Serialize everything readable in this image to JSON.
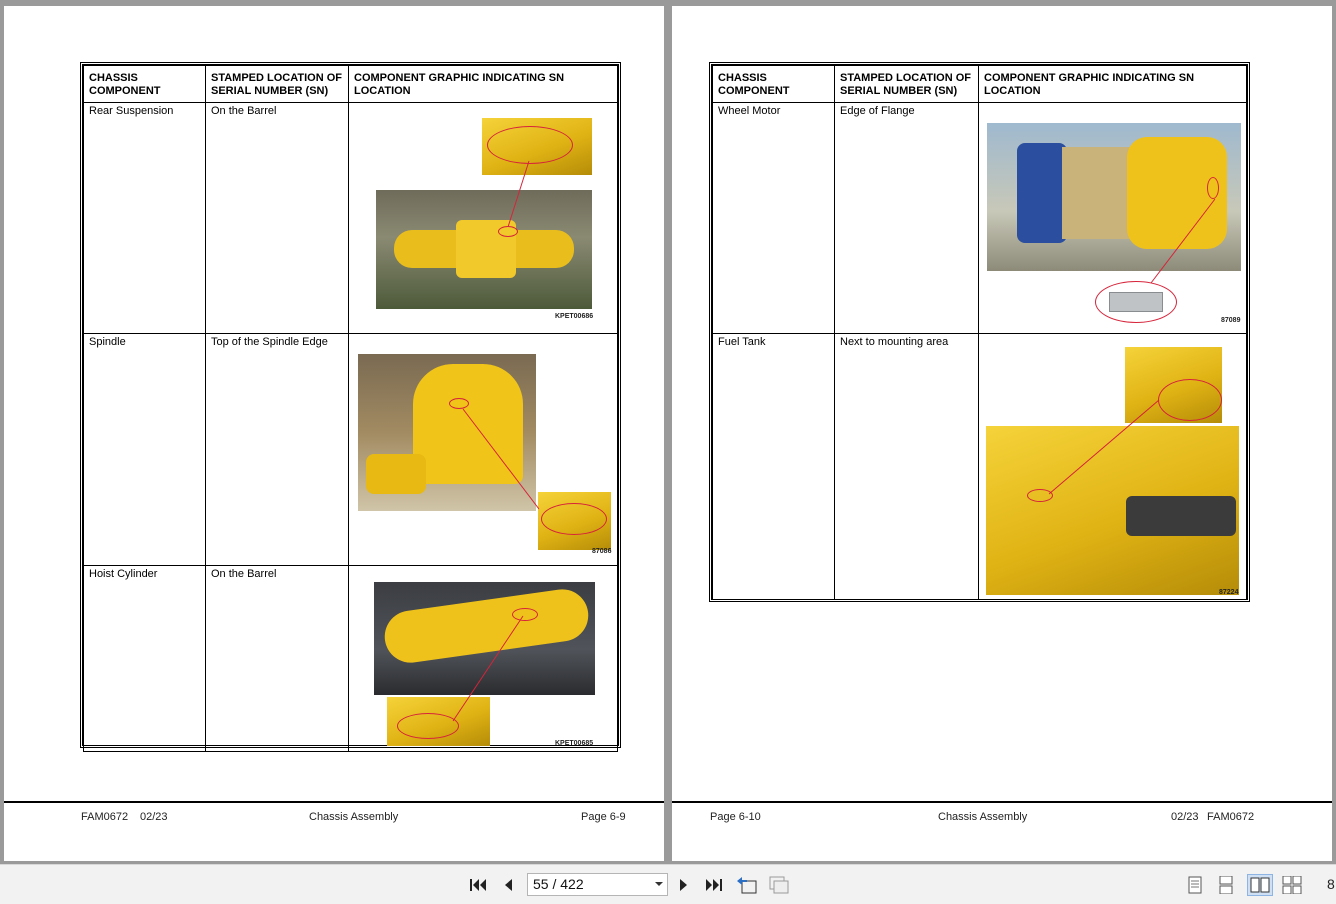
{
  "left_page": {
    "headers": [
      "CHASSIS COMPONENT",
      "STAMPED LOCATION OF SERIAL NUMBER (SN)",
      "COMPONENT GRAPHIC INDICATING SN LOCATION"
    ],
    "rows": [
      {
        "component": "Rear Suspension",
        "location": "On the Barrel",
        "figure_id": "KPET00686"
      },
      {
        "component": "Spindle",
        "location": "Top of the Spindle Edge",
        "figure_id": "87086"
      },
      {
        "component": "Hoist Cylinder",
        "location": "On the Barrel",
        "figure_id": "KPET00685"
      }
    ],
    "footer": {
      "doc": "FAM0672",
      "date": "02/23",
      "section": "Chassis Assembly",
      "page": "Page 6-9"
    }
  },
  "right_page": {
    "headers": [
      "CHASSIS COMPONENT",
      "STAMPED LOCATION OF SERIAL NUMBER (SN)",
      "COMPONENT GRAPHIC INDICATING SN LOCATION"
    ],
    "rows": [
      {
        "component": "Wheel Motor",
        "location": "Edge of Flange",
        "figure_id": "87089"
      },
      {
        "component": "Fuel Tank",
        "location": "Next to mounting area",
        "figure_id": "87224"
      }
    ],
    "footer": {
      "page": "Page 6-10",
      "section": "Chassis Assembly",
      "date": "02/23",
      "doc": "FAM0672"
    }
  },
  "toolbar": {
    "page_indicator": "55 / 422",
    "zoom_fragment": "8",
    "icons": [
      "first-page-icon",
      "previous-page-icon",
      "next-page-icon",
      "last-page-icon",
      "previous-view-icon",
      "next-view-icon",
      "single-page-view-icon",
      "continuous-view-icon",
      "facing-view-icon",
      "continuous-facing-view-icon"
    ]
  },
  "colors": {
    "annotation": "#d6243a",
    "machine_yellow": "#f0c419",
    "viewer_bg": "#9a9a9a",
    "toolbar_bg": "#f2f2f2"
  }
}
